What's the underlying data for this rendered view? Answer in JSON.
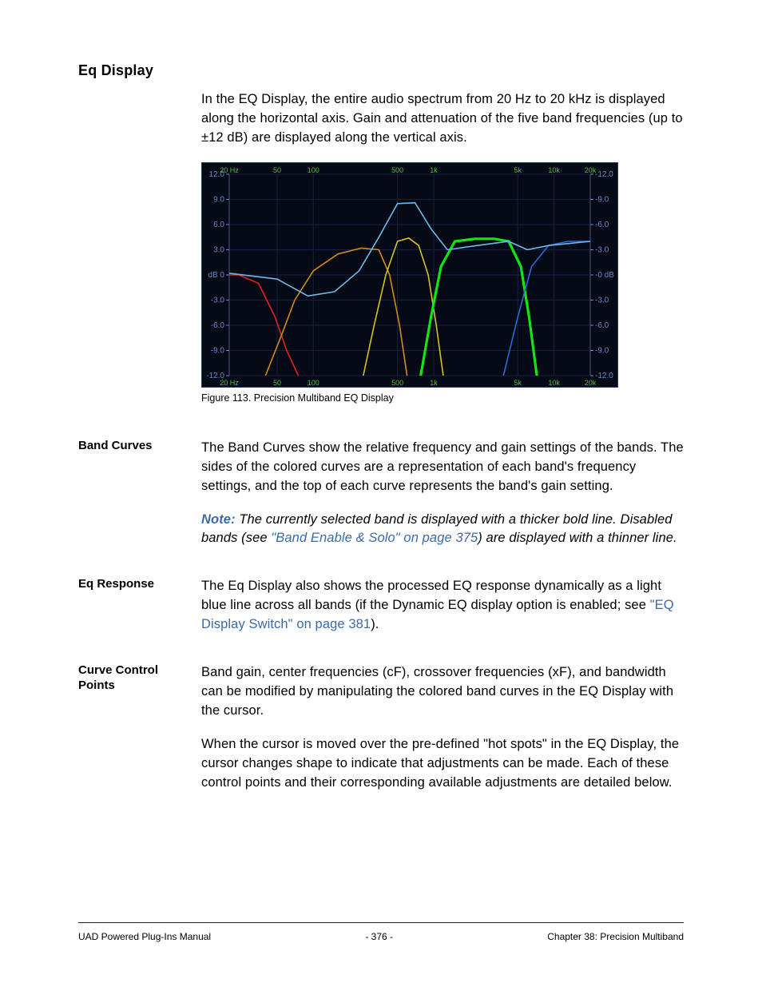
{
  "section_title": "Eq Display",
  "intro": "In the EQ Display, the entire audio spectrum from 20 Hz to 20 kHz is displayed along the horizontal axis. Gain and attenuation of the five band frequencies (up to ±12 dB) are displayed along the vertical axis.",
  "figure_caption": "Figure 113.  Precision Multiband EQ Display",
  "band_curves": {
    "label": "Band Curves",
    "para1": "The Band Curves show the relative frequency and gain settings of the bands. The sides of the colored curves are a representation of each band's frequency settings, and the top of each curve represents the band's gain setting.",
    "note_label": "Note:",
    "note_text_1": " The currently selected band is displayed with a thicker bold line. Disabled bands (see ",
    "note_xref": "\"Band Enable & Solo\" on page 375",
    "note_text_2": ") are displayed with a thinner line."
  },
  "eq_response": {
    "label": "Eq Response",
    "text_1": "The Eq Display also shows the processed EQ response dynamically as a light blue line across all bands (if the Dynamic EQ display option is enabled; see ",
    "xref": "\"EQ Display Switch\" on page 381",
    "text_2": ")."
  },
  "curve_control": {
    "label": "Curve Control Points",
    "para1": "Band gain, center frequencies (cF), crossover frequencies (xF), and bandwidth can be modified by manipulating the colored band curves in the EQ Display with the cursor.",
    "para2": "When the cursor is moved over the pre-defined \"hot spots\" in the EQ Display, the cursor changes shape to indicate that adjustments can be made. Each of these control points and their corresponding available adjustments are detailed below."
  },
  "footer": {
    "left": "UAD Powered Plug-Ins Manual",
    "center": "- 376 -",
    "right": "Chapter 38: Precision Multiband"
  },
  "chart_data": {
    "type": "line",
    "xlabel_top": [
      "20 Hz",
      "50",
      "100",
      "500",
      "1k",
      "5k",
      "10k",
      "20k"
    ],
    "xlabel_bottom": [
      "20 Hz",
      "50",
      "100",
      "500",
      "1k",
      "5k",
      "10k",
      "20k"
    ],
    "y_ticks_left": [
      "12.0",
      "9.0",
      "6.0",
      "3.0",
      "dB 0",
      "-3.0",
      "-6.0",
      "-9.0",
      "-12.0"
    ],
    "y_ticks_right": [
      "-12.0",
      "-9.0",
      "-6.0",
      "-3.0",
      "-0 dB",
      "-3.0",
      "-6.0",
      "-9.0",
      "-12.0"
    ],
    "ylim": [
      -12,
      12
    ],
    "x_range_hz": [
      20,
      20000
    ],
    "series": [
      {
        "name": "low (red)",
        "color": "#e02020",
        "points": [
          [
            20,
            0
          ],
          [
            24,
            0
          ],
          [
            35,
            -1
          ],
          [
            48,
            -5
          ],
          [
            60,
            -9
          ],
          [
            75,
            -12
          ]
        ]
      },
      {
        "name": "low-mid (orange)",
        "color": "#d38a1e",
        "points": [
          [
            40,
            -12
          ],
          [
            55,
            -7
          ],
          [
            70,
            -3
          ],
          [
            100,
            0.5
          ],
          [
            160,
            2.5
          ],
          [
            250,
            3.2
          ],
          [
            350,
            3.0
          ],
          [
            430,
            0
          ],
          [
            520,
            -6
          ],
          [
            600,
            -12
          ]
        ]
      },
      {
        "name": "mid (yellow)",
        "color": "#d4c322",
        "points": [
          [
            260,
            -12
          ],
          [
            320,
            -6
          ],
          [
            400,
            0
          ],
          [
            500,
            4
          ],
          [
            620,
            4.4
          ],
          [
            750,
            3.5
          ],
          [
            900,
            0
          ],
          [
            1050,
            -6
          ],
          [
            1200,
            -12
          ]
        ]
      },
      {
        "name": "high-mid (green, selected)",
        "color": "#12e612",
        "bold": true,
        "points": [
          [
            780,
            -12
          ],
          [
            950,
            -5
          ],
          [
            1150,
            1
          ],
          [
            1500,
            4
          ],
          [
            2200,
            4.3
          ],
          [
            3200,
            4.3
          ],
          [
            4200,
            4
          ],
          [
            5300,
            1
          ],
          [
            6200,
            -5
          ],
          [
            7200,
            -12
          ]
        ]
      },
      {
        "name": "high (blue)",
        "color": "#2a6ad6",
        "points": [
          [
            3800,
            -12
          ],
          [
            5000,
            -5
          ],
          [
            6500,
            1
          ],
          [
            9000,
            3.5
          ],
          [
            13000,
            4
          ],
          [
            20000,
            4
          ]
        ]
      },
      {
        "name": "response (light blue)",
        "color": "#6fb9e6",
        "points": [
          [
            20,
            0.2
          ],
          [
            50,
            -0.5
          ],
          [
            90,
            -2.5
          ],
          [
            150,
            -2.0
          ],
          [
            240,
            0.5
          ],
          [
            350,
            4.5
          ],
          [
            500,
            8.5
          ],
          [
            700,
            8.6
          ],
          [
            950,
            5.5
          ],
          [
            1300,
            3.0
          ],
          [
            2300,
            3.5
          ],
          [
            4200,
            4.0
          ],
          [
            6000,
            3.0
          ],
          [
            9000,
            3.5
          ],
          [
            20000,
            4.0
          ]
        ]
      }
    ],
    "grid_x_hz": [
      50,
      100,
      500,
      1000,
      5000,
      10000
    ],
    "title": "Precision Multiband EQ Display"
  }
}
